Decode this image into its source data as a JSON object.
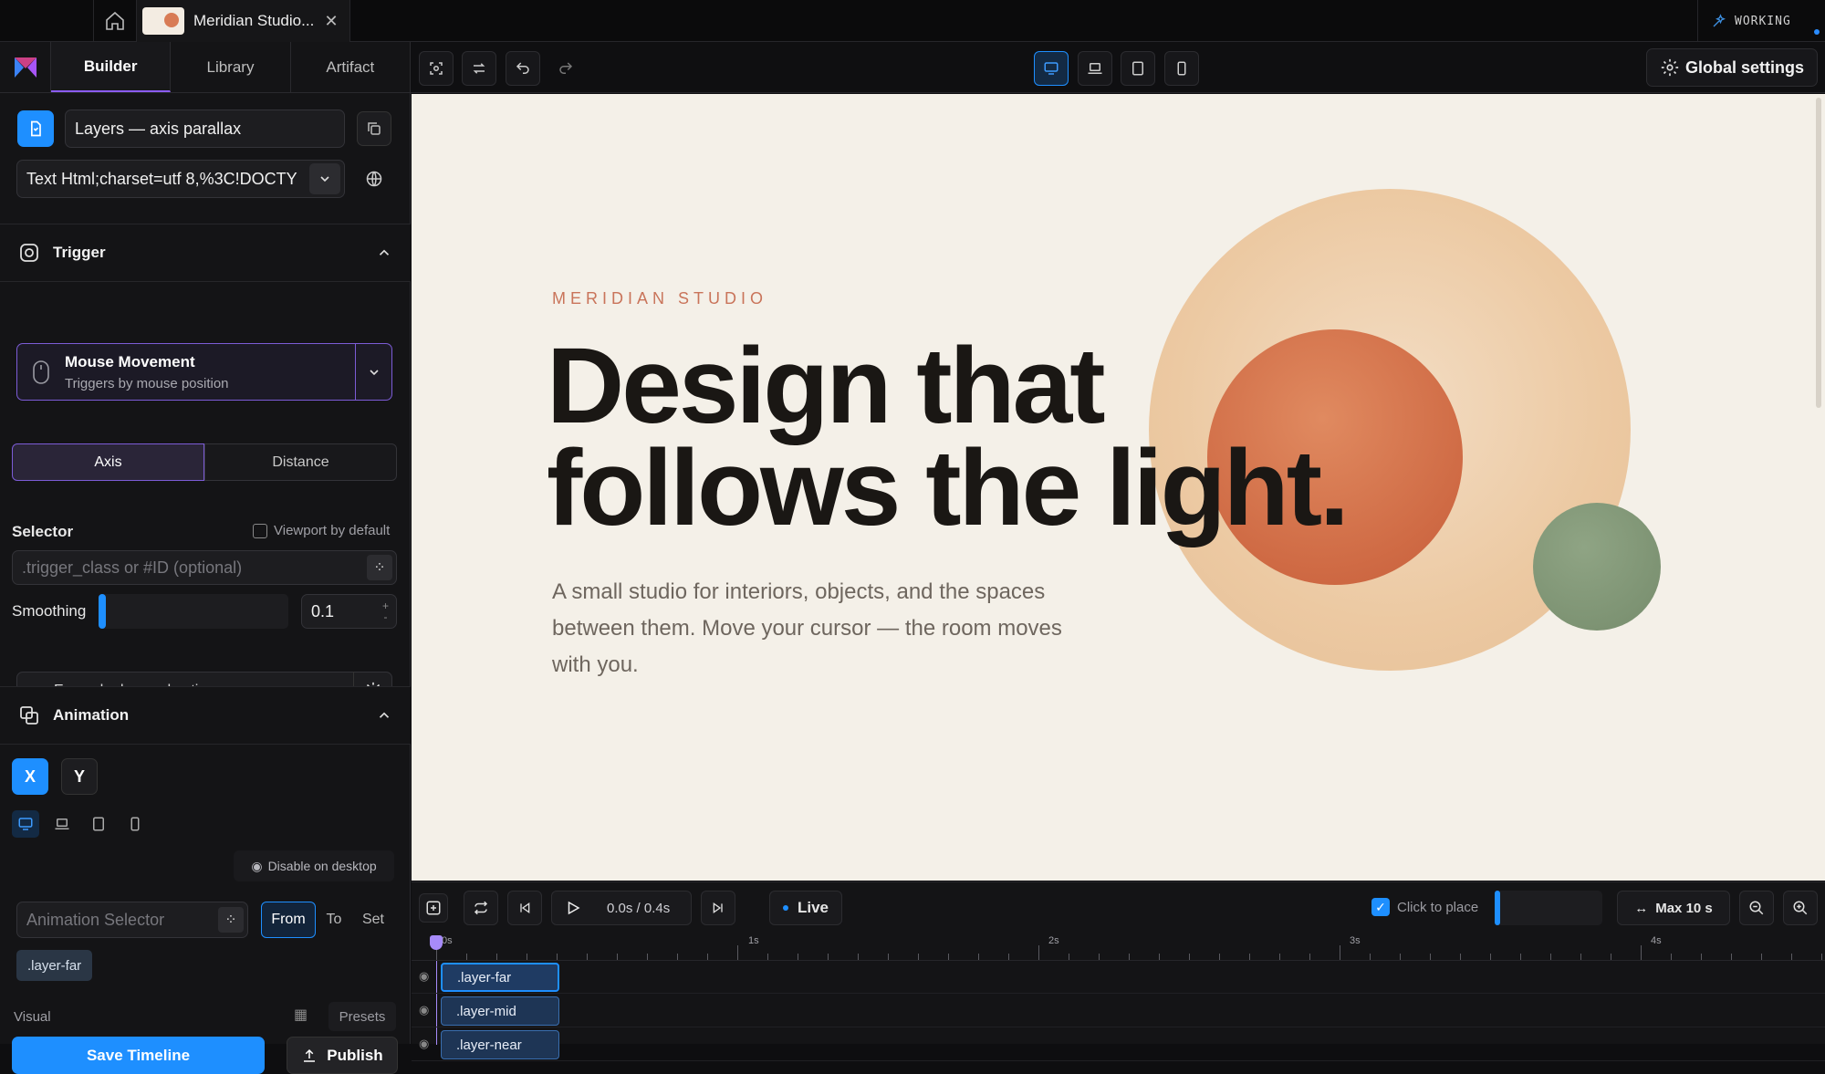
{
  "topbar": {
    "tab_title": "Meridian Studio...",
    "status": "WORKING"
  },
  "nav": {
    "tabs": [
      "Builder",
      "Library",
      "Artifact"
    ],
    "active": "Builder"
  },
  "project": {
    "name": "Layers — axis parallax",
    "source": "Text Html;charset=utf 8,%3C!DOCTY"
  },
  "trigger": {
    "section_label": "Trigger",
    "type_title": "Mouse Movement",
    "type_desc": "Triggers by mouse position",
    "modes": [
      "Axis",
      "Distance"
    ],
    "active_mode": "Axis",
    "selector_label": "Selector",
    "viewport_label": "Viewport by default",
    "selector_placeholder": ".trigger_class or #ID (optional)",
    "smoothing_label": "Smoothing",
    "smoothing_value": "0.1",
    "expand_label": "Expand advanced options"
  },
  "animation": {
    "section_label": "Animation",
    "axes": [
      "X",
      "Y"
    ],
    "active_axis": "X",
    "disable_label": "Disable on desktop",
    "selector_placeholder": "Animation Selector",
    "from_to_set": [
      "From",
      "To",
      "Set"
    ],
    "tag": ".layer-far",
    "visual_label": "Visual",
    "presets_label": "Presets"
  },
  "actions": {
    "save": "Save Timeline",
    "publish": "Publish"
  },
  "toolbar": {
    "global_settings": "Global settings"
  },
  "canvas": {
    "eyebrow": "MERIDIAN STUDIO",
    "headline_line1": "Design that",
    "headline_line2": "follows the light.",
    "subtext": "A small studio for interiors, objects, and the spaces between them. Move your cursor — the room moves with you."
  },
  "timeline": {
    "time": "0.0s / 0.4s",
    "live": "Live",
    "click_to_place": "Click to place",
    "max": "Max 10 s",
    "ruler_labels": [
      "0s",
      "1s",
      "2s",
      "3s",
      "4s"
    ],
    "tracks": [
      ".layer-far",
      ".layer-mid",
      ".layer-near"
    ]
  },
  "colors": {
    "accent": "#1e8fff",
    "purple": "#8b5cf6",
    "canvas_bg": "#f4f0e8",
    "eyebrow": "#c9745a"
  }
}
